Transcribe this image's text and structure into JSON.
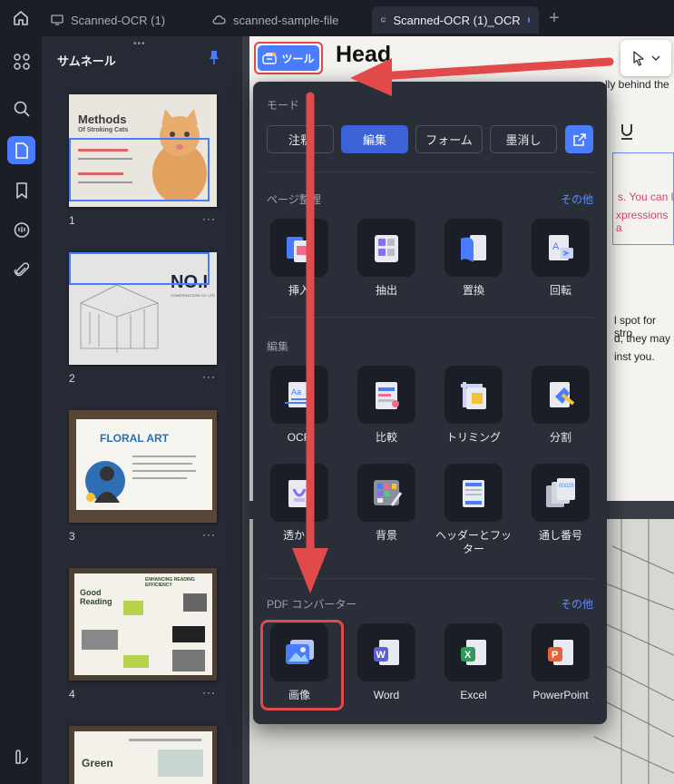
{
  "tabs": [
    {
      "label": "Scanned-OCR (1)",
      "icon": "monitor-icon"
    },
    {
      "label": "scanned-sample-file",
      "icon": "cloud-icon"
    },
    {
      "label": "Scanned-OCR (1)_OCR",
      "icon": "monitor-icon",
      "active": true
    }
  ],
  "thumbnails": {
    "title": "サムネール",
    "pages": [
      {
        "num": "1",
        "title": "Methods",
        "subtitle": "Of Stroking Cats"
      },
      {
        "num": "2",
        "title": "NO.I",
        "subtitle": "CONSTRUCTION CO. LTD"
      },
      {
        "num": "3",
        "title": "FLORAL ART"
      },
      {
        "num": "4",
        "title": "Good Reading",
        "subtitle": "ENHANCING READING EFFICIENCY"
      },
      {
        "num": "",
        "title": "Green"
      }
    ],
    "more": "···"
  },
  "document": {
    "heading": "Head",
    "line1": "lly behind the",
    "pink1": "s. You can l",
    "pink2": "xpressions a",
    "body1": "l spot for stro",
    "body2": "d, they may",
    "body3": "inst you."
  },
  "toolbar": {
    "tools_label": "ツール"
  },
  "panel": {
    "mode_label": "モード",
    "modes": [
      "注釈",
      "編集",
      "フォーム",
      "墨消し"
    ],
    "page_section": "ページ整理",
    "page_more": "その他",
    "page_tools": [
      "挿入",
      "抽出",
      "置換",
      "回転"
    ],
    "edit_section": "編集",
    "edit_tools": [
      "OCR",
      "比較",
      "トリミング",
      "分割",
      "透かし",
      "背景",
      "ヘッダーとフッター",
      "通し番号"
    ],
    "converter_section": "PDF コンバーター",
    "converter_more": "その他",
    "converter_tools": [
      "画像",
      "Word",
      "Excel",
      "PowerPoint"
    ]
  },
  "colors": {
    "accent": "#4a7cff",
    "highlight": "#e04a4a"
  }
}
